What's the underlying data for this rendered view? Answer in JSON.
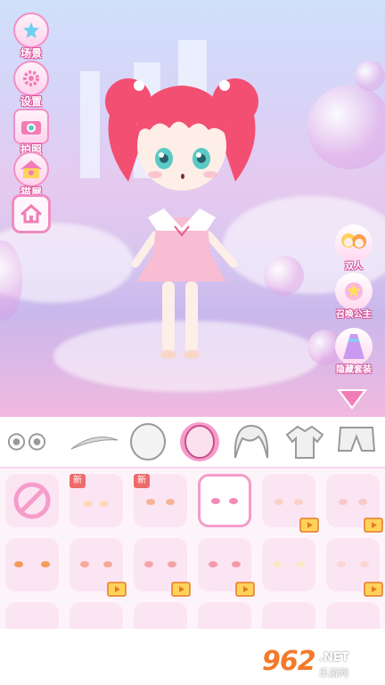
{
  "left_menu": [
    {
      "label": "场景",
      "icon": "scene-icon"
    },
    {
      "label": "设置",
      "icon": "settings-icon"
    },
    {
      "label": "拍照",
      "icon": "camera-icon"
    },
    {
      "label": "猫屋",
      "icon": "cat-house-icon"
    }
  ],
  "home_button": {
    "icon": "home-icon"
  },
  "right_menu": [
    {
      "label": "双人",
      "icon": "two-characters-icon"
    },
    {
      "label": "召唤公主",
      "icon": "summon-princess-icon"
    },
    {
      "label": "隐藏套装",
      "icon": "hidden-outfit-icon"
    }
  ],
  "collapse_button": {
    "icon": "triangle-down-icon"
  },
  "category_tabs": [
    {
      "name": "eyes",
      "icon": "eyes-icon"
    },
    {
      "name": "eyebrows",
      "icon": "eyebrow-icon"
    },
    {
      "name": "face",
      "icon": "face-outline-icon"
    },
    {
      "name": "blush",
      "icon": "face-blush-icon",
      "active": true
    },
    {
      "name": "hair",
      "icon": "hair-icon"
    },
    {
      "name": "top",
      "icon": "shirt-icon"
    },
    {
      "name": "bottom",
      "icon": "pants-icon"
    }
  ],
  "items": {
    "new_badge": "新",
    "rows": 3,
    "selected_index": 2
  },
  "watermark": {
    "logo": "962",
    "net": ".NET",
    "sub": "乐游网"
  },
  "colors": {
    "accent": "#f59ccb",
    "brand_border": "#f08bc1",
    "new_badge": "#ee6b6b"
  }
}
